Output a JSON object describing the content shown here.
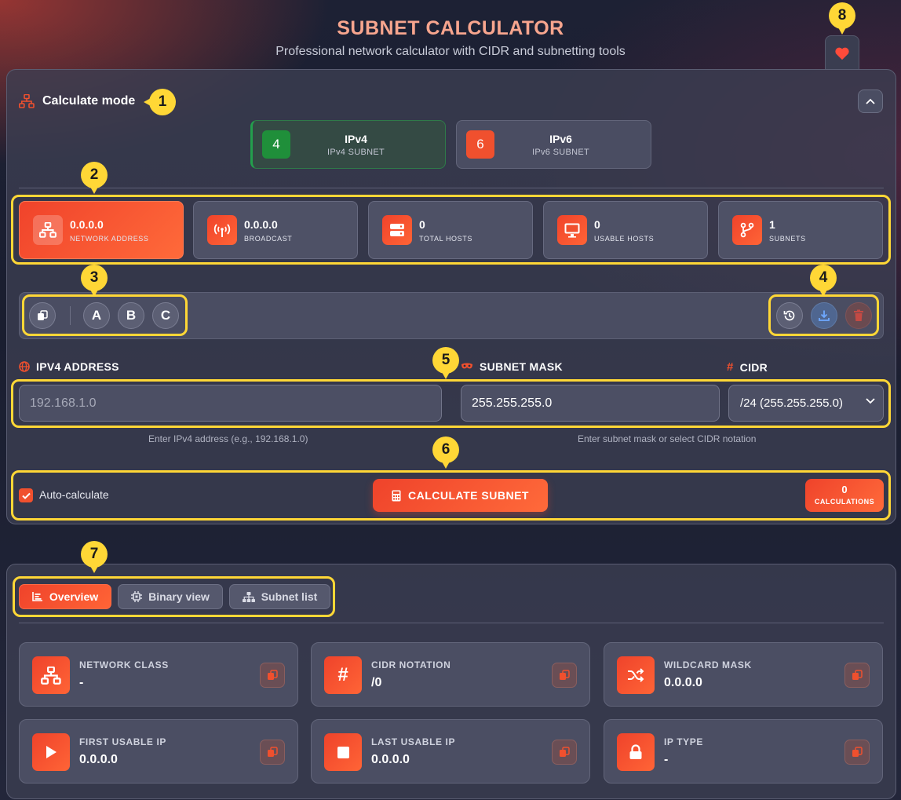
{
  "header": {
    "title": "SUBNET CALCULATOR",
    "subtitle": "Professional network calculator with CIDR and subnetting tools"
  },
  "callouts": [
    "1",
    "2",
    "3",
    "4",
    "5",
    "6",
    "7",
    "8"
  ],
  "mode": {
    "title": "Calculate mode",
    "options": [
      {
        "num": "4",
        "name": "IPv4",
        "sub": "IPv4 SUBNET",
        "active": true,
        "color": "#1f8f3a"
      },
      {
        "num": "6",
        "name": "IPv6",
        "sub": "IPv6 SUBNET",
        "active": false,
        "color": "#f0502e"
      }
    ]
  },
  "stats": [
    {
      "value": "0.0.0.0",
      "label": "NETWORK ADDRESS",
      "icon": "network-icon"
    },
    {
      "value": "0.0.0.0",
      "label": "BROADCAST",
      "icon": "broadcast-icon"
    },
    {
      "value": "0",
      "label": "TOTAL HOSTS",
      "icon": "server-icon"
    },
    {
      "value": "0",
      "label": "USABLE HOSTS",
      "icon": "monitor-icon"
    },
    {
      "value": "1",
      "label": "SUBNETS",
      "icon": "branch-icon"
    }
  ],
  "toolbar": {
    "class_buttons": [
      "A",
      "B",
      "C"
    ]
  },
  "fields": {
    "ip_label": "IPV4 ADDRESS",
    "ip_placeholder": "192.168.1.0",
    "ip_hint": "Enter IPv4 address (e.g., 192.168.1.0)",
    "mask_label": "SUBNET MASK",
    "mask_value": "255.255.255.0",
    "cidr_label": "CIDR",
    "cidr_value": "/24 (255.255.255.0)",
    "mask_hint": "Enter subnet mask or select CIDR notation"
  },
  "actions": {
    "auto_calculate": "Auto-calculate",
    "calculate_button": "CALCULATE SUBNET",
    "calc_count": "0",
    "calc_count_label": "CALCULATIONS"
  },
  "tabs": [
    {
      "label": "Overview",
      "active": true
    },
    {
      "label": "Binary view",
      "active": false
    },
    {
      "label": "Subnet list",
      "active": false
    }
  ],
  "details": [
    {
      "label": "NETWORK CLASS",
      "value": "-"
    },
    {
      "label": "CIDR NOTATION",
      "value": "/0"
    },
    {
      "label": "WILDCARD MASK",
      "value": "0.0.0.0"
    },
    {
      "label": "FIRST USABLE IP",
      "value": "0.0.0.0"
    },
    {
      "label": "LAST USABLE IP",
      "value": "0.0.0.0"
    },
    {
      "label": "IP TYPE",
      "value": "-"
    }
  ],
  "colors": {
    "accent": "#f0502e",
    "highlight": "#ffd736",
    "title": "#f7a58e",
    "ipv4_badge": "#1f8f3a"
  }
}
